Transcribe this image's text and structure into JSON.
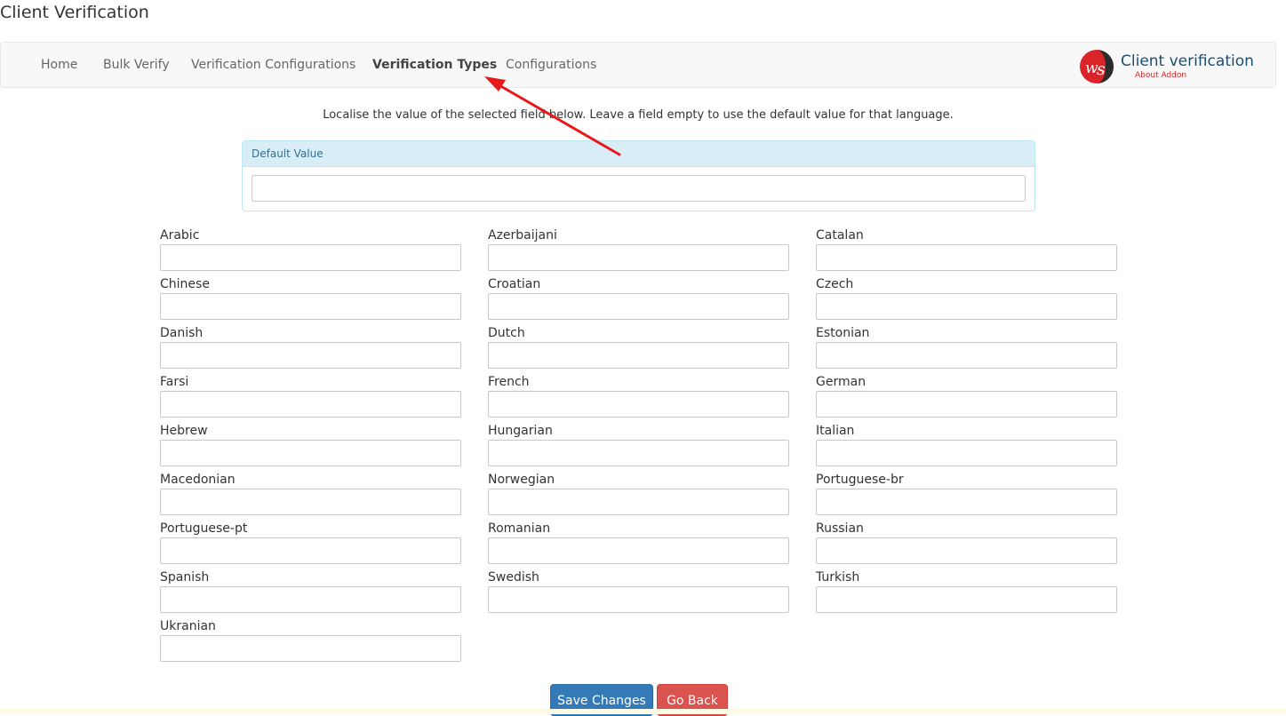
{
  "page": {
    "title": "Client Verification"
  },
  "nav": {
    "items": [
      {
        "label": "Home",
        "active": false
      },
      {
        "label": "Bulk Verify",
        "active": false
      },
      {
        "label": "Verification Configurations",
        "active": false
      },
      {
        "label": "Verification Types",
        "active": true
      },
      {
        "label": "Configurations",
        "active": false
      }
    ],
    "logo": {
      "title": "Client verification",
      "subtitle": "About Addon",
      "mark": "WS"
    }
  },
  "instruction": "Localise the value of the selected field below. Leave a field empty to use the default value for that language.",
  "default_panel": {
    "heading": "Default Value",
    "value": ""
  },
  "languages": [
    "Arabic",
    "Azerbaijani",
    "Catalan",
    "Chinese",
    "Croatian",
    "Czech",
    "Danish",
    "Dutch",
    "Estonian",
    "Farsi",
    "French",
    "German",
    "Hebrew",
    "Hungarian",
    "Italian",
    "Macedonian",
    "Norwegian",
    "Portuguese-br",
    "Portuguese-pt",
    "Romanian",
    "Russian",
    "Spanish",
    "Swedish",
    "Turkish",
    "Ukranian"
  ],
  "buttons": {
    "save": "Save Changes",
    "back": "Go Back"
  },
  "colors": {
    "primary": "#337ab7",
    "danger": "#d9534f",
    "panel_heading": "#d9edf7",
    "annotation_arrow": "#e8191b"
  }
}
